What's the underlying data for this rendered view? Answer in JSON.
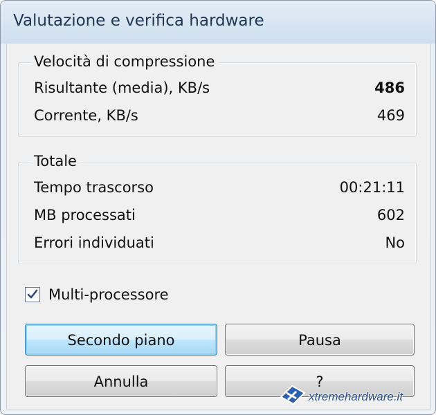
{
  "window": {
    "title": "Valutazione e verifica hardware"
  },
  "compression": {
    "legend": "Velocità di compressione",
    "rows": [
      {
        "label": "Risultante (media), KB/s",
        "value": "486"
      },
      {
        "label": "Corrente, KB/s",
        "value": "469"
      }
    ]
  },
  "totals": {
    "legend": "Totale",
    "rows": [
      {
        "label": "Tempo trascorso",
        "value": "00:21:11"
      },
      {
        "label": "MB processati",
        "value": "602"
      },
      {
        "label": "Errori individuati",
        "value": "No"
      }
    ]
  },
  "multiprocessor": {
    "label": "Multi-processore",
    "checked": true
  },
  "buttons": {
    "background": "Secondo piano",
    "pause": "Pausa",
    "cancel": "Annulla",
    "help": "?"
  },
  "watermark": {
    "text": "xtremehardware.it",
    "icon": "xtremehardware-logo"
  },
  "colors": {
    "title_text": "#1e3553",
    "default_button": "#3c7fb1",
    "check": "#2e4a7a"
  }
}
